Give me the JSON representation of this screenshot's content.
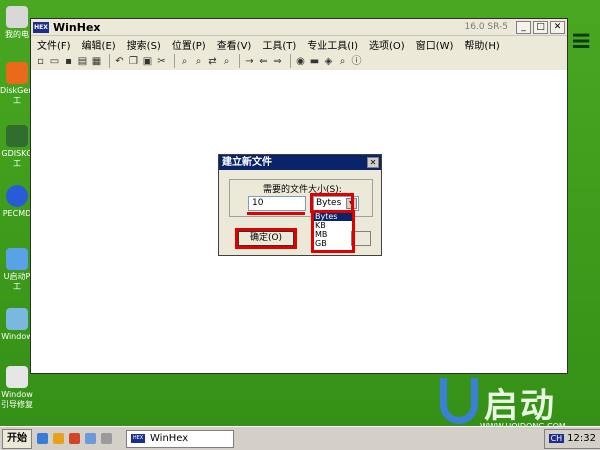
{
  "desktop": {
    "icons": [
      {
        "label": "我的电",
        "color": "#d8d8d8"
      },
      {
        "label": "DiskGeni工",
        "color": "#e86a1a"
      },
      {
        "label": "GDISKG工",
        "color": "#2f6e2f"
      },
      {
        "label": "PECMD",
        "color": "#2a5bd6"
      },
      {
        "label": "U启动P工",
        "color": "#5aa2e8"
      },
      {
        "label": "Window",
        "color": "#7ab8e0"
      },
      {
        "label": "Window引导修复",
        "color": "#e6e6e6"
      }
    ],
    "brand_text": "启动",
    "brand_url": "WWW.UQIDONG.COM"
  },
  "window": {
    "title": "WinHex",
    "app_icon_text": "HEX",
    "version": "16.0 SR-5",
    "controls": [
      "_",
      "□",
      "✕"
    ],
    "menu": [
      "文件(F)",
      "编辑(E)",
      "搜索(S)",
      "位置(P)",
      "查看(V)",
      "工具(T)",
      "专业工具(I)",
      "选项(O)",
      "窗口(W)",
      "帮助(H)"
    ],
    "toolbar_icons": [
      "new-icon",
      "open-icon",
      "save-icon",
      "print-icon",
      "properties-icon",
      "undo-icon",
      "copy-icon",
      "paste-icon",
      "cut-icon",
      "find-icon",
      "find-hex-icon",
      "replace-icon",
      "find-next-icon",
      "goto-icon",
      "back-icon",
      "forward-icon",
      "disk-icon",
      "ram-icon",
      "image-icon",
      "search-tool-icon",
      "info-icon"
    ]
  },
  "dialog": {
    "title": "建立新文件",
    "size_label": "需要的文件大小(S):",
    "size_value": "10",
    "unit_selected": "Bytes",
    "unit_options": [
      "Bytes",
      "KB",
      "MB",
      "GB"
    ],
    "ok_label": "确定(O)"
  },
  "taskbar": {
    "start_label": "开始",
    "task_icon_text": "HEX",
    "task_label": "WinHex",
    "lang": "CH",
    "clock": "12:32"
  }
}
